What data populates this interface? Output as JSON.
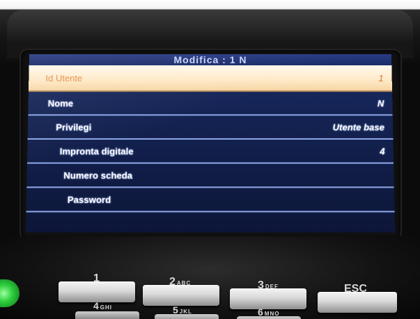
{
  "screen": {
    "title": "Modifica : 1 N",
    "rows": [
      {
        "label": "Id Utente",
        "value": "1"
      },
      {
        "label": "Nome",
        "value": "N"
      },
      {
        "label": "Privilegi",
        "value": "Utente base"
      },
      {
        "label": "Impronta digitale",
        "value": "4"
      },
      {
        "label": "Numero scheda",
        "value": ""
      },
      {
        "label": "Password",
        "value": ""
      }
    ]
  },
  "keypad": {
    "keys": [
      {
        "label": "1",
        "sub": ""
      },
      {
        "label": "2",
        "sub": "ABC"
      },
      {
        "label": "3",
        "sub": "DEF"
      },
      {
        "label": "ESC",
        "sub": ""
      }
    ],
    "lower_keys": [
      {
        "label": "4",
        "sub": "GHI"
      },
      {
        "label": "5",
        "sub": "JKL"
      },
      {
        "label": "6",
        "sub": "MNO"
      }
    ]
  }
}
